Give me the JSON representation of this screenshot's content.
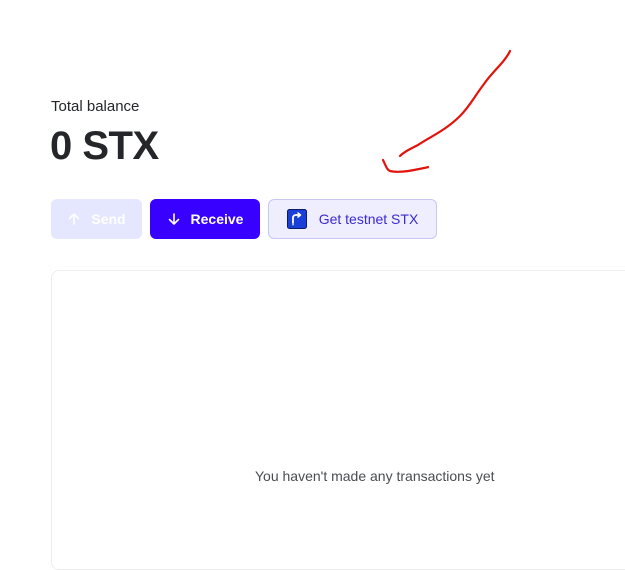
{
  "balance": {
    "label": "Total balance",
    "value": "0 STX"
  },
  "actions": {
    "send_label": "Send",
    "receive_label": "Receive",
    "testnet_label": "Get testnet STX"
  },
  "transactions": {
    "empty_message": "You haven't made any transactions yet"
  },
  "icons": {
    "send": "arrow-up-icon",
    "receive": "arrow-down-icon",
    "testnet": "faucet-icon",
    "annotation": "red-arrow-annotation"
  },
  "colors": {
    "accent": "#3700ff",
    "send_disabled": "#e5e6ff",
    "testnet_bg": "#eeeeff",
    "testnet_text": "#3a2bd0",
    "annotation": "#e3120b"
  }
}
